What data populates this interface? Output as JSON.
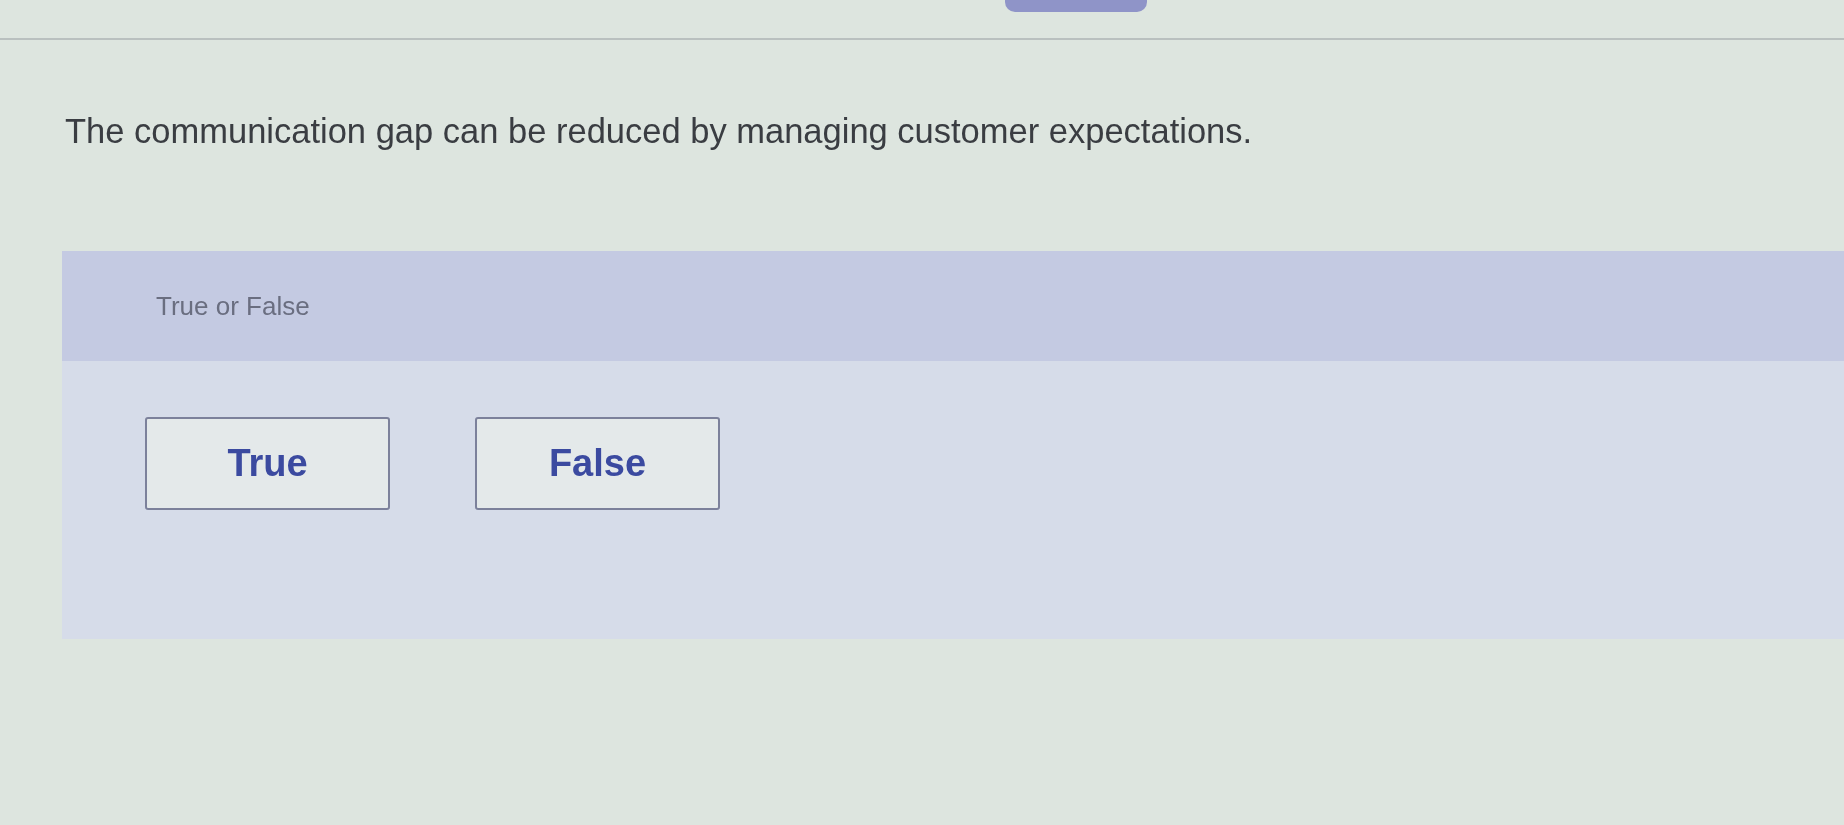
{
  "question": {
    "text": "The communication gap can be reduced by managing customer expectations."
  },
  "answer_panel": {
    "prompt": "True or False",
    "options": [
      {
        "label": "True",
        "selected": false
      },
      {
        "label": "False",
        "selected": false
      }
    ]
  }
}
